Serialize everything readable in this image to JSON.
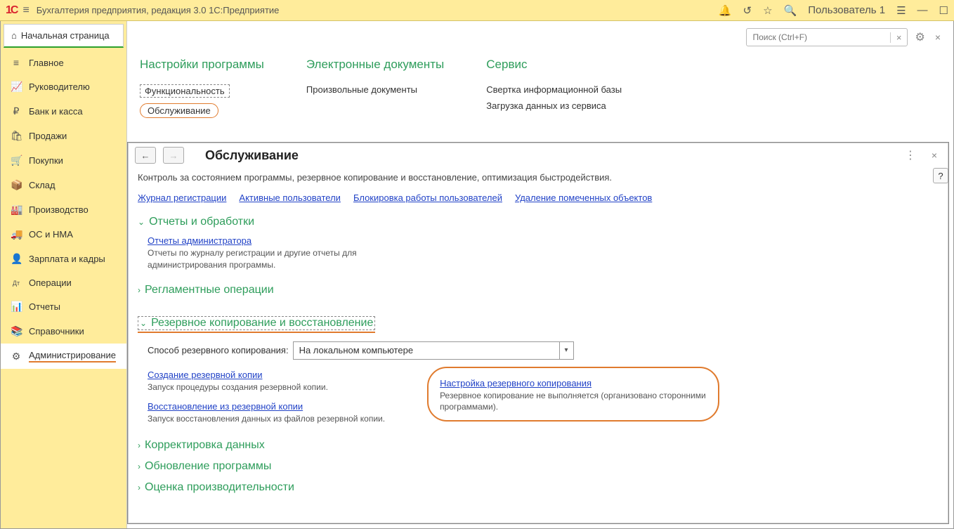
{
  "titlebar": {
    "title": "Бухгалтерия предприятия, редакция 3.0 1С:Предприятие",
    "user": "Пользователь 1"
  },
  "start_tab": "Начальная страница",
  "sidebar": [
    {
      "icon": "≡",
      "label": "Главное"
    },
    {
      "icon": "📈",
      "label": "Руководителю"
    },
    {
      "icon": "₽",
      "label": "Банк и касса"
    },
    {
      "icon": "🛍",
      "label": "Продажи"
    },
    {
      "icon": "🛒",
      "label": "Покупки"
    },
    {
      "icon": "📦",
      "label": "Склад"
    },
    {
      "icon": "🏭",
      "label": "Производство"
    },
    {
      "icon": "🚚",
      "label": "ОС и НМА"
    },
    {
      "icon": "👤",
      "label": "Зарплата и кадры"
    },
    {
      "icon": "Дт",
      "label": "Операции"
    },
    {
      "icon": "📊",
      "label": "Отчеты"
    },
    {
      "icon": "📚",
      "label": "Справочники"
    },
    {
      "icon": "⚙",
      "label": "Администрирование"
    }
  ],
  "search_placeholder": "Поиск (Ctrl+F)",
  "settings": {
    "col1": {
      "head": "Настройки программы",
      "items": [
        "Функциональность",
        "Обслуживание"
      ]
    },
    "col2": {
      "head": "Электронные документы",
      "items": [
        "Произвольные документы"
      ]
    },
    "col3": {
      "head": "Сервис",
      "items": [
        "Свертка информационной базы",
        "Загрузка данных из сервиса"
      ]
    }
  },
  "sw": {
    "title": "Обслуживание",
    "desc": "Контроль за состоянием программы, резервное копирование и восстановление, оптимизация быстродействия.",
    "toplinks": [
      "Журнал регистрации",
      "Активные пользователи",
      "Блокировка работы пользователей",
      "Удаление помеченных объектов"
    ],
    "sec_reports": "Отчеты и обработки",
    "admin_reports_link": "Отчеты администратора",
    "admin_reports_desc": "Отчеты по журналу регистрации и другие отчеты для администрирования программы.",
    "sec_reg": "Регламентные операции",
    "sec_backup": "Резервное копирование и восстановление",
    "backup_label": "Способ резервного копирования:",
    "backup_value": "На локальном компьютере",
    "left": {
      "l1": "Создание резервной копии",
      "d1": "Запуск процедуры создания резервной копии.",
      "l2": "Восстановление из резервной копии",
      "d2": "Запуск восстановления данных из файлов резервной копии."
    },
    "right": {
      "l1": "Настройка резервного копирования",
      "d1": "Резервное копирование не выполняется (организовано сторонними программами)."
    },
    "sec_corr": "Корректировка данных",
    "sec_upd": "Обновление программы",
    "sec_perf": "Оценка производительности",
    "help": "?"
  }
}
